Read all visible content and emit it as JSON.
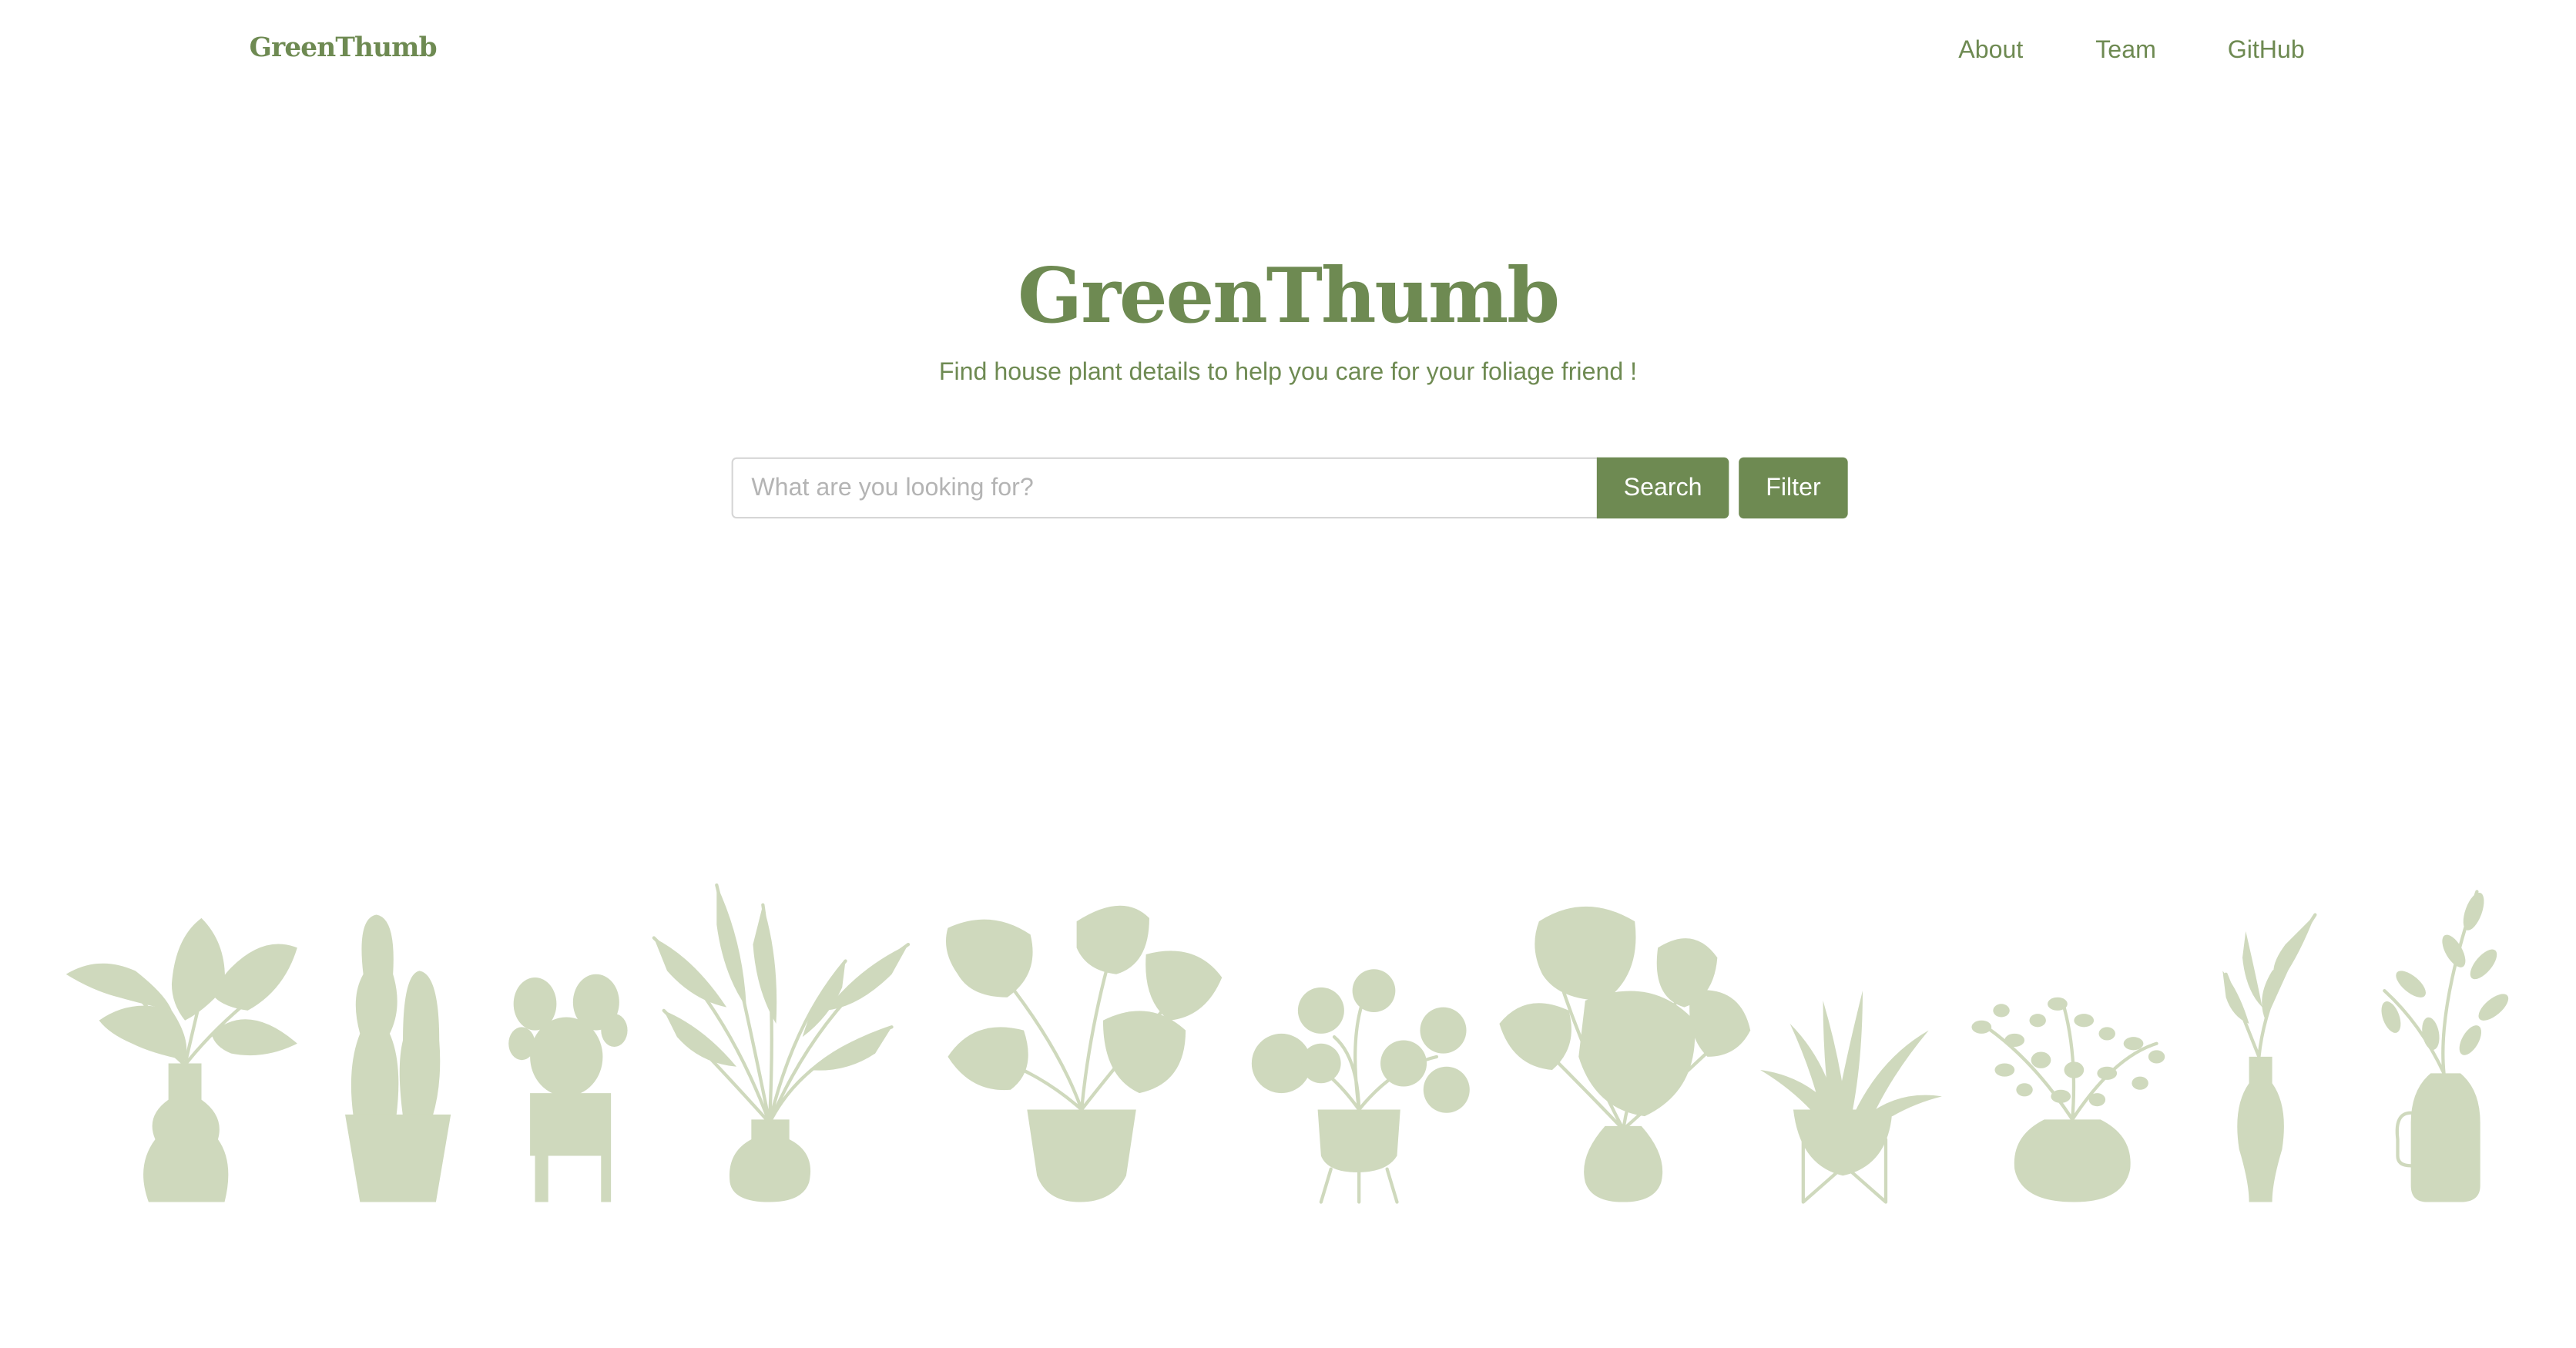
{
  "header": {
    "brand": "GreenThumb",
    "nav": [
      {
        "label": "About"
      },
      {
        "label": "Team"
      },
      {
        "label": "GitHub"
      }
    ]
  },
  "hero": {
    "title": "GreenThumb",
    "subtitle": "Find house plant details to help you care for your foliage friend !"
  },
  "search": {
    "placeholder": "What are you looking for?",
    "value": "",
    "search_label": "Search",
    "filter_label": "Filter"
  },
  "colors": {
    "brand": "#6e8a52",
    "illustration": "#cfd9bd",
    "input_border": "#d6d6d6"
  },
  "illustration": {
    "icons": [
      "potted-leafy-plant-icon",
      "tall-cactus-icon",
      "prickly-pear-cactus-icon",
      "palm-plant-icon",
      "monstera-basket-icon",
      "pilea-plant-icon",
      "monstera-vase-icon",
      "spiky-plant-stand-icon",
      "small-leaf-shrub-icon",
      "fern-vase-icon",
      "leafy-jug-icon"
    ]
  }
}
